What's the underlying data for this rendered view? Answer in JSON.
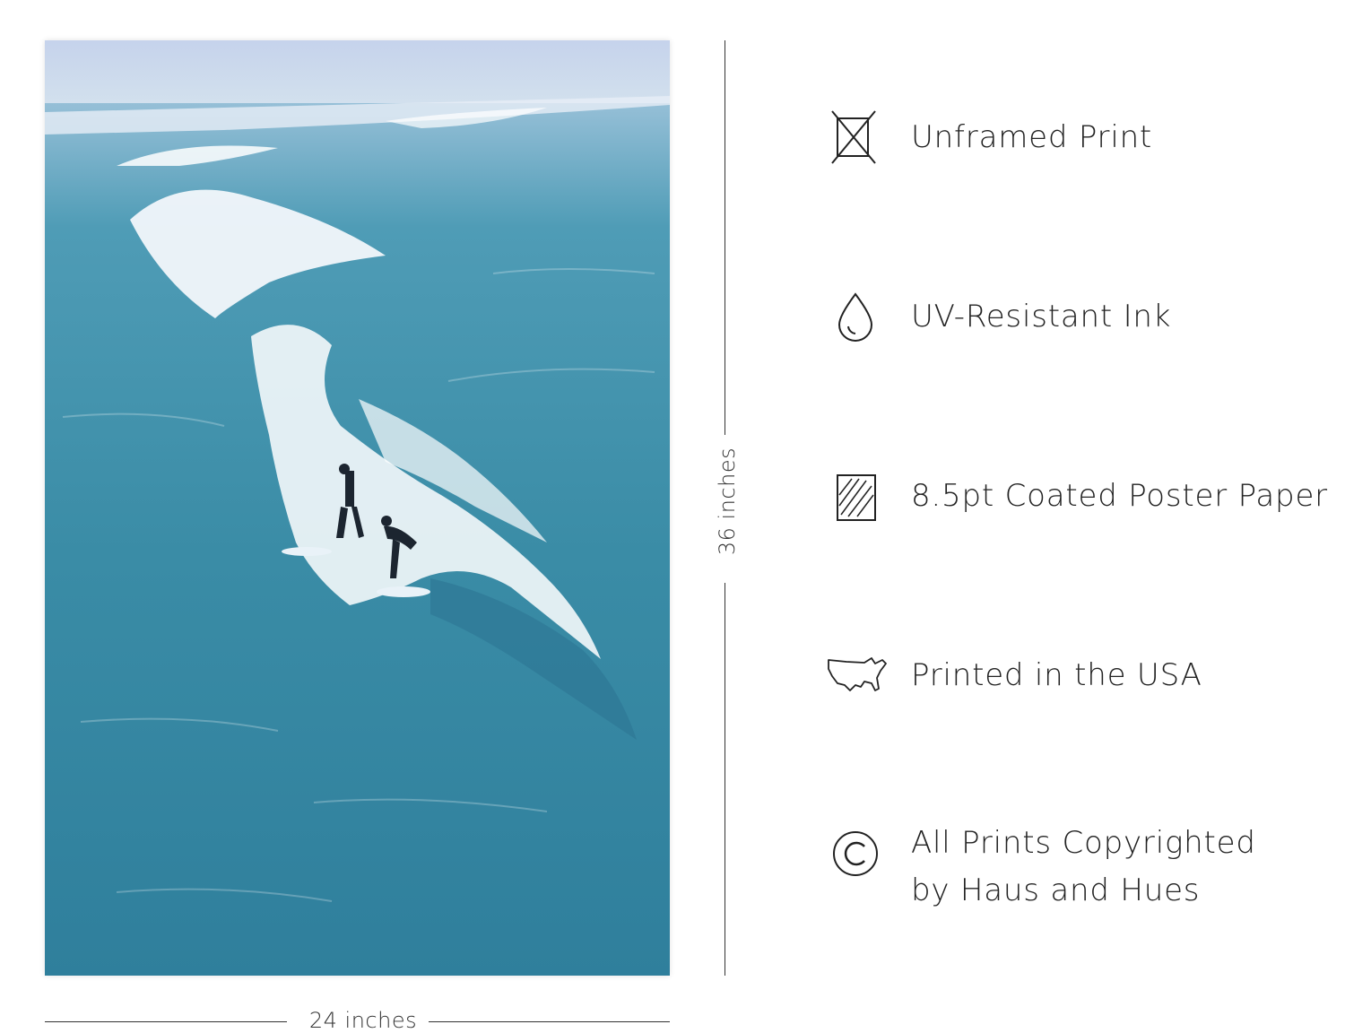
{
  "dimensions": {
    "width_label": "24 inches",
    "height_label": "36 inches"
  },
  "poster": {
    "image": "surfers-on-wave-photo"
  },
  "features": [
    {
      "icon": "unframed-icon",
      "label": "Unframed Print"
    },
    {
      "icon": "ink-drop-icon",
      "label": "UV-Resistant Ink"
    },
    {
      "icon": "paper-icon",
      "label": "8.5pt Coated Poster Paper"
    },
    {
      "icon": "usa-map-icon",
      "label": "Printed in the USA"
    },
    {
      "icon": "copyright-icon",
      "label_line1": "All Prints Copyrighted",
      "label_line2": "by Haus and Hues"
    }
  ],
  "colors": {
    "sea": "#3f8fa6",
    "sky": "#c9d8ea",
    "text": "#222222"
  }
}
